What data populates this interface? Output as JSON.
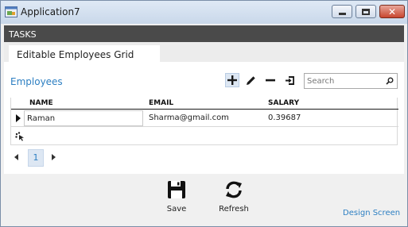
{
  "window": {
    "title": "Application7"
  },
  "tasks": {
    "label": "TASKS"
  },
  "tab": {
    "label": "Editable Employees Grid"
  },
  "section": {
    "title": "Employees"
  },
  "search": {
    "placeholder": "Search",
    "value": ""
  },
  "grid": {
    "columns": [
      "NAME",
      "EMAIL",
      "SALARY"
    ],
    "rows": [
      {
        "name": "Raman",
        "email": "Sharma@gmail.com",
        "salary": "0.39687"
      }
    ]
  },
  "pager": {
    "current_page": "1"
  },
  "commands": {
    "save_label": "Save",
    "refresh_label": "Refresh"
  },
  "links": {
    "design_screen": "Design Screen"
  },
  "colors": {
    "accent": "#2d7fc2",
    "tasks_bar": "#4a4a4a",
    "close_button": "#c8462f"
  },
  "icons": {
    "app": "app-window-icon",
    "add": "plus-icon",
    "edit": "pencil-icon",
    "remove": "minus-icon",
    "export": "export-icon",
    "search": "magnifier-icon",
    "save": "floppy-disk-icon",
    "refresh": "refresh-icon"
  }
}
